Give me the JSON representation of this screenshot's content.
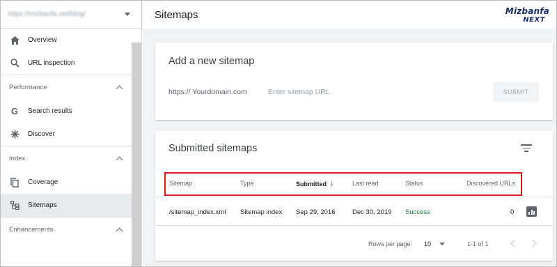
{
  "header": {
    "title": "Sitemaps"
  },
  "logo": {
    "line1": "Mizbanfa",
    "line2": "NEXT"
  },
  "property": {
    "url": "https://mizbanfa.net/blog/"
  },
  "sidebar": {
    "top_items": [
      {
        "label": "Overview",
        "icon": "home-icon"
      },
      {
        "label": "URL inspection",
        "icon": "search-icon"
      }
    ],
    "sections": [
      {
        "label": "Performance",
        "items": [
          {
            "label": "Search results",
            "icon": "google-g-icon"
          },
          {
            "label": "Discover",
            "icon": "asterisk-icon"
          }
        ]
      },
      {
        "label": "Index",
        "items": [
          {
            "label": "Coverage",
            "icon": "copy-icon"
          },
          {
            "label": "Sitemaps",
            "icon": "sitemap-icon",
            "active": true
          }
        ]
      },
      {
        "label": "Enhancements",
        "items": []
      }
    ]
  },
  "add_card": {
    "title": "Add a new sitemap",
    "prefix": "https:// Yourdomain.com",
    "input_placeholder": "Enter sitemap URL",
    "input_value": "",
    "submit_label": "SUBMIT"
  },
  "submitted_card": {
    "title": "Submitted sitemaps",
    "columns": [
      "Sitemap",
      "Type",
      "Submitted",
      "Last read",
      "Status",
      "Discovered URLs"
    ],
    "sorted_column": "Submitted",
    "rows": [
      {
        "sitemap": "/sitemap_index.xml",
        "type": "Sitemap index",
        "submitted": "Sep 29, 2016",
        "last_read": "Dec 30, 2019",
        "status": "Success",
        "discovered": "0"
      }
    ],
    "pagination": {
      "rows_label": "Rows per page:",
      "rows_value": "10",
      "range": "1-1 of 1"
    }
  },
  "colors": {
    "success": "#188038",
    "highlight": "#e3151a",
    "active_bg": "#e8eaed"
  }
}
